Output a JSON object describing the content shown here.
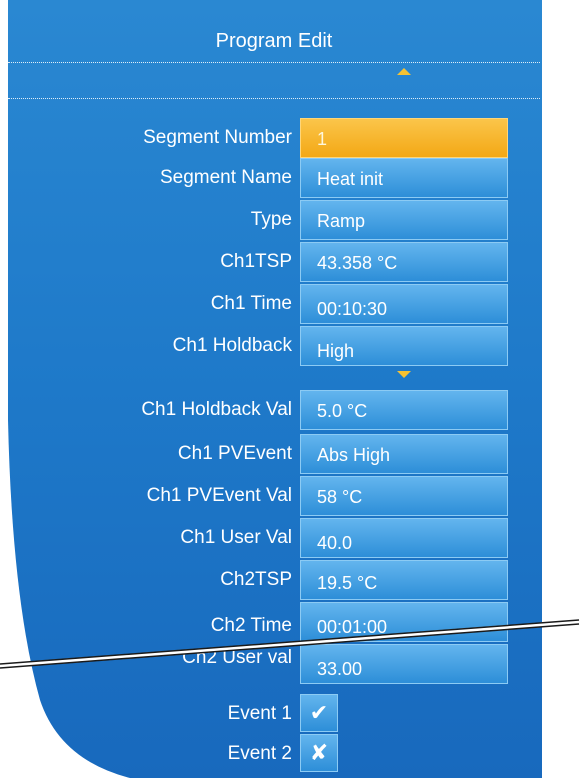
{
  "header": {
    "title": "Program Edit"
  },
  "rows": [
    {
      "label": "Segment Number",
      "value": "1"
    },
    {
      "label": "Segment Name",
      "value": "Heat init"
    },
    {
      "label": "Type",
      "value": "Ramp"
    },
    {
      "label": "Ch1TSP",
      "value": "43.358 °C"
    },
    {
      "label": "Ch1 Time",
      "value": "00:10:30"
    },
    {
      "label": "Ch1 Holdback",
      "value": "High"
    },
    {
      "label": "Ch1 Holdback Val",
      "value": "5.0 °C"
    },
    {
      "label": "Ch1 PVEvent",
      "value": "Abs High"
    },
    {
      "label": "Ch1 PVEvent Val",
      "value": "58 °C"
    },
    {
      "label": "Ch1 User Val",
      "value": "40.0"
    },
    {
      "label": "Ch2TSP",
      "value": "19.5 °C"
    },
    {
      "label": "Ch2 Time",
      "value": "00:01:00"
    },
    {
      "label": "Ch2 User val",
      "value": "33.00"
    }
  ],
  "events": [
    {
      "label": "Event 1",
      "state": "✔",
      "icon": "check-icon"
    },
    {
      "label": "Event 2",
      "state": "✘",
      "icon": "cross-icon"
    }
  ],
  "colors": {
    "panel_top": "#1f7dcc",
    "panel_bottom": "#1a6fc0",
    "selected": "#f7b52a"
  }
}
